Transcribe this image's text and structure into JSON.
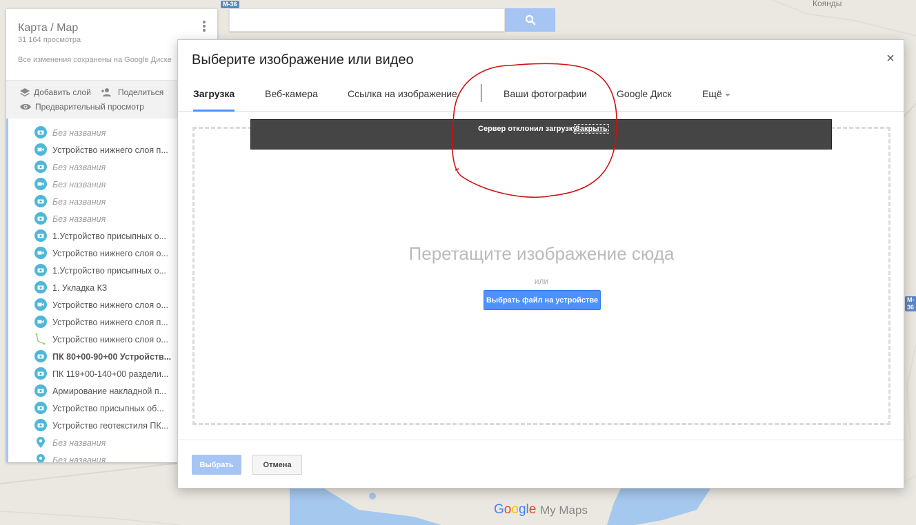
{
  "map": {
    "road_labels": [
      "M-36",
      "M-36"
    ],
    "place_labels": [
      "Коянды"
    ],
    "branding": {
      "logo_letters": [
        "G",
        "o",
        "o",
        "g",
        "l",
        "e"
      ],
      "product": "My Maps"
    }
  },
  "search": {
    "placeholder": "",
    "icon": "search-icon"
  },
  "left_panel": {
    "title": "Карта / Map",
    "views": "31 164 просмотра",
    "saved_status": "Все изменения сохранены на Google Диске",
    "actions": {
      "add_layer": "Добавить слой",
      "share": "Поделиться",
      "preview": "Предварительный просмотр"
    },
    "items": [
      {
        "label": "Без названия",
        "icon": "camera-icon",
        "style": "unnamed"
      },
      {
        "label": "Устройство нижнего слоя п...",
        "icon": "video-icon",
        "style": "normal"
      },
      {
        "label": "Без названия",
        "icon": "camera-icon",
        "style": "unnamed"
      },
      {
        "label": "Без названия",
        "icon": "video-icon",
        "style": "unnamed"
      },
      {
        "label": "Без названия",
        "icon": "camera-icon",
        "style": "unnamed"
      },
      {
        "label": "Без названия",
        "icon": "camera-icon",
        "style": "unnamed"
      },
      {
        "label": "1.Устройство присыпных о...",
        "icon": "camera-icon",
        "style": "normal"
      },
      {
        "label": "Устройство нижнего слоя о...",
        "icon": "video-icon",
        "style": "normal"
      },
      {
        "label": "1.Устройство присыпных о...",
        "icon": "camera-icon",
        "style": "normal"
      },
      {
        "label": "1. Укладка КЗ",
        "icon": "camera-icon",
        "style": "normal"
      },
      {
        "label": "Устройство нижнего слоя о...",
        "icon": "video-icon",
        "style": "normal"
      },
      {
        "label": "Устройство нижнего слоя п...",
        "icon": "video-icon",
        "style": "normal"
      },
      {
        "label": "Устройство нижнего слоя о...",
        "icon": "line-icon",
        "style": "normal"
      },
      {
        "label": "ПК 80+00-90+00 Устройств...",
        "icon": "camera-icon",
        "style": "bold"
      },
      {
        "label": "ПК 119+00-140+00 раздели...",
        "icon": "camera-icon",
        "style": "normal"
      },
      {
        "label": "Армирование накладной п...",
        "icon": "camera-icon",
        "style": "normal"
      },
      {
        "label": "Устройство присыпных об...",
        "icon": "camera-icon",
        "style": "normal"
      },
      {
        "label": "Устройство геотекстиля ПК...",
        "icon": "camera-icon",
        "style": "normal"
      },
      {
        "label": "Без названия",
        "icon": "pin-icon",
        "style": "unnamed"
      },
      {
        "label": "Без названия",
        "icon": "pin-icon",
        "style": "unnamed"
      }
    ]
  },
  "dialog": {
    "title": "Выберите изображение или видео",
    "close": "×",
    "tabs": [
      {
        "label": "Загрузка",
        "active": true
      },
      {
        "label": "Веб-камера",
        "active": false
      },
      {
        "label": "Ссылка на изображение",
        "active": false
      },
      {
        "label": "Ваши фотографии",
        "active": false
      },
      {
        "label": "Google Диск",
        "active": false
      },
      {
        "label": "Ещё",
        "active": false
      }
    ],
    "error": {
      "message": "Сервер отклонил загрузку",
      "close_link": "Закрыть"
    },
    "dropzone": {
      "headline": "Перетащите изображение сюда",
      "or": "или",
      "choose_button": "Выбрать файл на устройстве"
    },
    "footer": {
      "select_button": "Выбрать",
      "cancel_button": "Отмена"
    }
  },
  "colors": {
    "accent": "#4d90fe",
    "accent_disabled": "#a6c5f5",
    "annotation": "#d01010",
    "error_banner": "#454545",
    "layer_icon": "#4fb8d8"
  }
}
